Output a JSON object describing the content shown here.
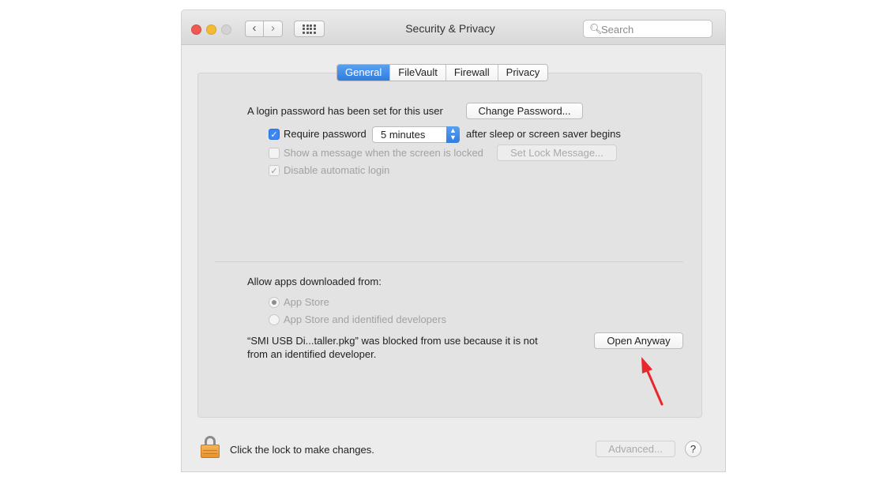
{
  "window": {
    "title": "Security & Privacy",
    "search_placeholder": "Search",
    "nav_back": "‹",
    "nav_forward": "›"
  },
  "tabs": [
    {
      "label": "General",
      "active": true
    },
    {
      "label": "FileVault",
      "active": false
    },
    {
      "label": "Firewall",
      "active": false
    },
    {
      "label": "Privacy",
      "active": false
    }
  ],
  "general": {
    "login_text": "A login password has been set for this user",
    "change_password_button": "Change Password...",
    "require_password_label": "Require password",
    "require_password_checked": true,
    "require_password_delay": "5 minutes",
    "after_sleep_text": "after sleep or screen saver begins",
    "show_message_label": "Show a message when the screen is locked",
    "show_message_checked": false,
    "set_lock_message_button": "Set Lock Message...",
    "disable_auto_login_label": "Disable automatic login",
    "disable_auto_login_checked": true
  },
  "apps": {
    "heading": "Allow apps downloaded from:",
    "options": [
      {
        "label": "App Store",
        "selected": true
      },
      {
        "label": "App Store and identified developers",
        "selected": false
      }
    ],
    "blocked_line1": "“SMI USB Di...taller.pkg” was blocked from use because it is not",
    "blocked_line2": "from an identified developer.",
    "open_anyway_button": "Open Anyway"
  },
  "footer": {
    "lock_text": "Click the lock to make changes.",
    "advanced_button": "Advanced...",
    "help_button": "?"
  },
  "colors": {
    "accent": "#2f7de0",
    "annotation_arrow": "#e8262b",
    "lock": "#f0a040"
  }
}
